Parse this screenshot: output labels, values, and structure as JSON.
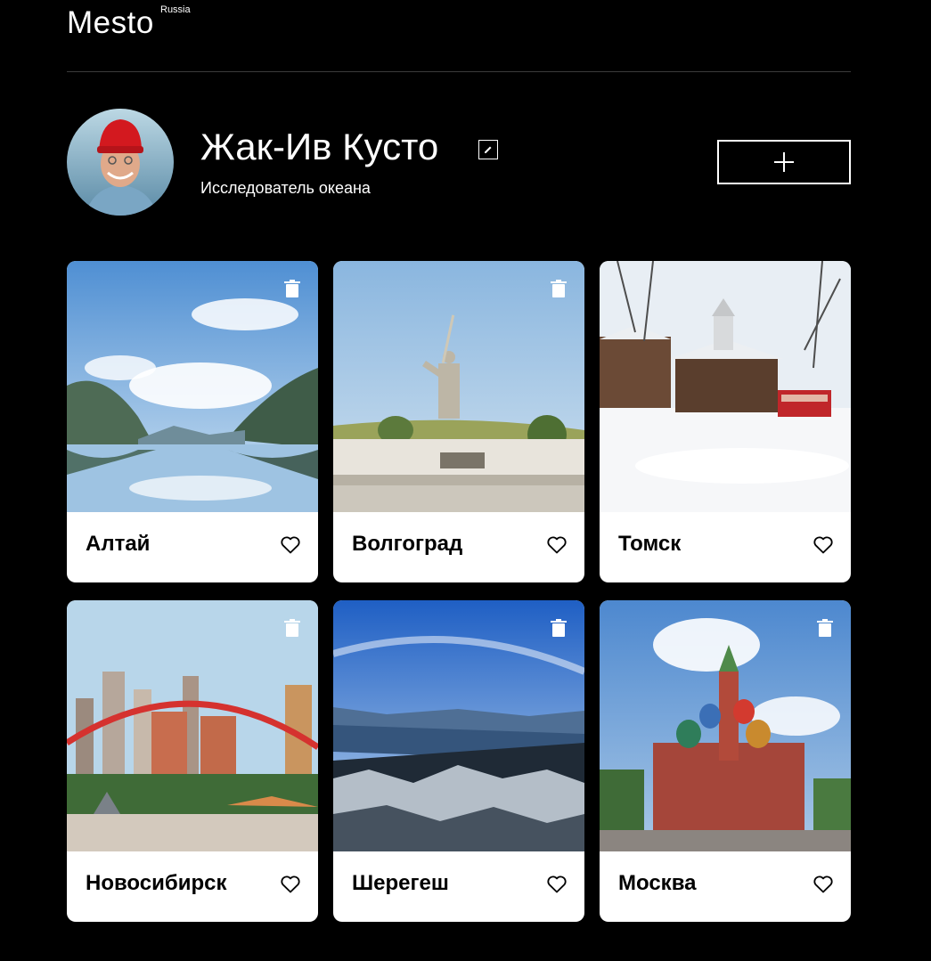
{
  "header": {
    "logo": "Mesto",
    "logo_sup": "Russia"
  },
  "profile": {
    "name": "Жак-Ив Кусто",
    "about": "Исследователь океана",
    "edit_icon": "pencil-icon",
    "add_icon": "plus-icon"
  },
  "cards": [
    {
      "title": "Алтай",
      "liked": false
    },
    {
      "title": "Волгоград",
      "liked": false
    },
    {
      "title": "Томск",
      "liked": false
    },
    {
      "title": "Новосибирск",
      "liked": false
    },
    {
      "title": "Шерегеш",
      "liked": false
    },
    {
      "title": "Москва",
      "liked": false
    }
  ],
  "colors": {
    "background": "#000000",
    "card": "#ffffff",
    "text_dark": "#000000",
    "divider": "#545454"
  }
}
